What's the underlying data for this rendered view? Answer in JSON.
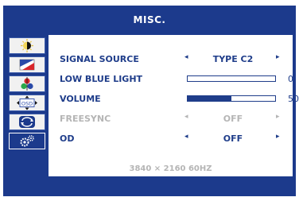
{
  "header": {
    "title": "MISC."
  },
  "sidebar": {
    "items": [
      {
        "icon": "brightness-icon"
      },
      {
        "icon": "color-icon"
      },
      {
        "icon": "picture-icon"
      },
      {
        "icon": "osd-setup-icon"
      },
      {
        "icon": "reset-icon"
      },
      {
        "icon": "misc-settings-icon",
        "selected": true
      }
    ]
  },
  "settings": {
    "signal_source": {
      "label": "SIGNAL SOURCE",
      "value": "TYPE C2",
      "enabled": true
    },
    "low_blue_light": {
      "label": "LOW BLUE LIGHT",
      "value": "0",
      "level": 0
    },
    "volume": {
      "label": "VOLUME",
      "value": "50",
      "level": 50
    },
    "freesync": {
      "label": "FREESYNC",
      "value": "OFF",
      "enabled": false
    },
    "od": {
      "label": "OD",
      "value": "OFF",
      "enabled": true
    }
  },
  "arrows": {
    "left": "◂",
    "right": "▸"
  },
  "status": {
    "resolution": "3840 × 2160 60HZ"
  },
  "colors": {
    "osd_blue": "#1c3a8c",
    "text_blue": "#1f3d8a",
    "disabled_gray": "#b5b5b5",
    "panel": "#ffffff"
  }
}
